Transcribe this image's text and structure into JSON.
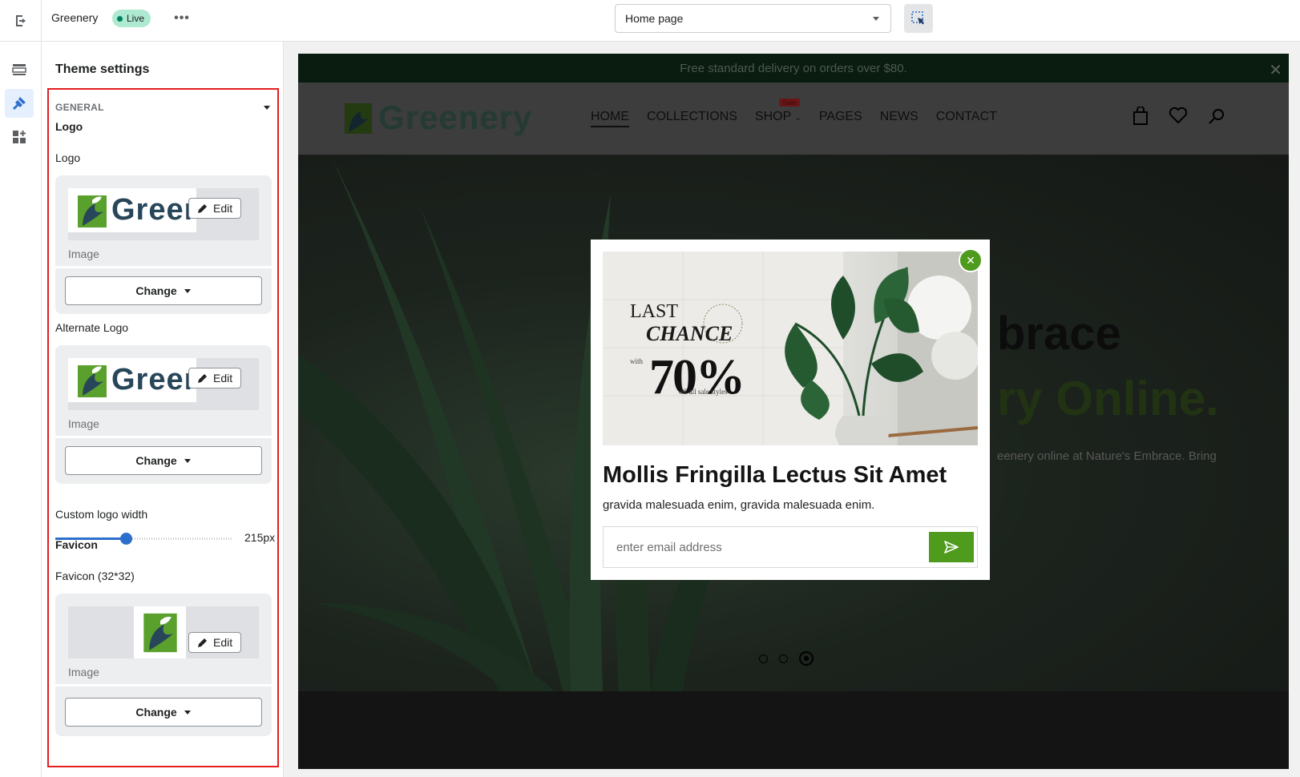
{
  "topbar": {
    "store_name": "Greenery",
    "status_badge": "Live",
    "page_select": "Home page"
  },
  "panel": {
    "title": "Theme settings",
    "section": "GENERAL",
    "logo_heading": "Logo",
    "logo_label": "Logo",
    "alt_logo_label": "Alternate Logo",
    "image_label": "Image",
    "edit_label": "Edit",
    "change_label": "Change",
    "logo_width_label": "Custom logo width",
    "logo_width_value": "215px",
    "logo_width_fraction": 0.4,
    "favicon_heading": "Favicon",
    "favicon_label": "Favicon (32*32)",
    "thumb_logo_word": "Greer"
  },
  "preview": {
    "announcement": "Free standard delivery on orders over $80.",
    "site_logo": "Greenery",
    "nav": [
      "HOME",
      "COLLECTIONS",
      "SHOP",
      "PAGES",
      "NEWS",
      "CONTACT"
    ],
    "sale_tag": "Sale",
    "hero_title_1": "brace",
    "hero_title_2": "ry Online.",
    "hero_text": "eenery online at Nature's Embrace. Bring",
    "popup": {
      "promo_line1": "LAST",
      "promo_line2": "CHANCE",
      "promo_with": "with",
      "promo_percent": "70%",
      "promo_off": "off all sale styles",
      "title": "Mollis Fringilla Lectus Sit Amet",
      "subtitle": "gravida malesuada enim, gravida malesuada enim.",
      "email_placeholder": "enter email address"
    }
  },
  "colors": {
    "accent": "#2c6ecb",
    "highlight_outline": "#e41e1e",
    "brand_green": "#4e9b1d",
    "live_badge": "#aee9d1"
  }
}
